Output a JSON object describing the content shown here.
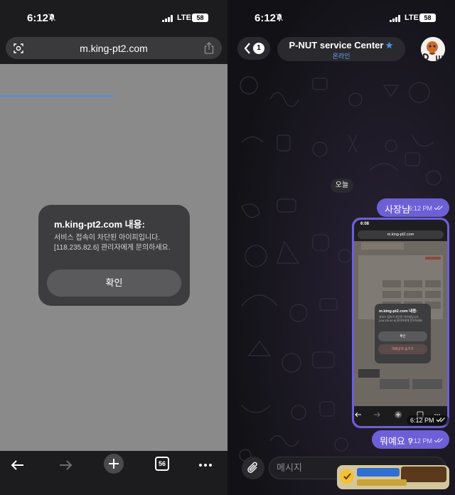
{
  "left": {
    "status": {
      "time": "6:12",
      "network": "LTE",
      "battery": "58"
    },
    "url": "m.king-pt2.com",
    "dialog": {
      "title": "m.king-pt2.com 내용:",
      "message": "서비스 접속이 차단된 아이피입니다. [118.235.82.6] 관리자에게 문의하세요.",
      "button": "확인"
    },
    "bottom": {
      "tab_count": "56"
    }
  },
  "right": {
    "status": {
      "time": "6:12",
      "network": "LTE",
      "battery": "58"
    },
    "header": {
      "back_count": "1",
      "title": "P-NUT service Center",
      "status": "온라인"
    },
    "date_chip": "오늘",
    "messages": [
      {
        "text": "사장님",
        "time": "6:12 PM"
      },
      {
        "text": "뭐예요 ?",
        "time": "6:12 PM"
      }
    ],
    "image_message": {
      "time": "6:12 PM",
      "shot_time": "6:08",
      "shot_url": "m.king-pt2.com",
      "shot_dialog_title": "m.king-pt2.com 내용:",
      "shot_dialog_message": "서비스 접속이 차단된 아이피입니다. [118.235.82.6] 관리자에게 문의하세요.",
      "shot_ok": "확인",
      "shot_secondary": "대화상자 숨기기"
    },
    "composer": {
      "placeholder": "메시지"
    },
    "watermark": "스포츠토토 정보 토토군 BEST 검증커뮤니티"
  },
  "colors": {
    "accent_blue": "#4a90e2",
    "bubble_purple": "#6d5fd6",
    "online_blue": "#6aa7ff"
  },
  "icons": [
    "bell-slash-icon",
    "signal-icon",
    "battery-icon",
    "page-info-icon",
    "share-icon",
    "back-arrow-icon",
    "forward-arrow-icon",
    "plus-icon",
    "tabs-icon",
    "more-icon",
    "chevron-left-icon",
    "verified-star-icon",
    "double-check-icon",
    "paperclip-icon"
  ]
}
